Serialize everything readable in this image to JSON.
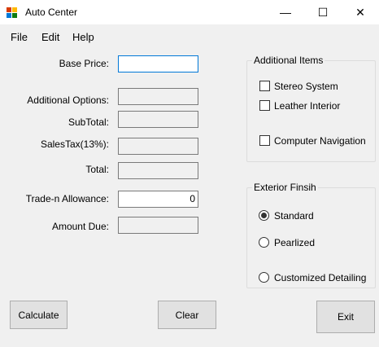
{
  "window": {
    "title": "Auto Center",
    "icon": "app-window-icon",
    "controls": {
      "minimize": "—",
      "maximize": "☐",
      "close": "✕"
    }
  },
  "menu": [
    "File",
    "Edit",
    "Help"
  ],
  "fields": {
    "base_price": {
      "label": "Base Price:",
      "value": ""
    },
    "additional_options": {
      "label": "Additional Options:",
      "value": ""
    },
    "subtotal": {
      "label": "SubTotal:",
      "value": ""
    },
    "sales_tax": {
      "label": "SalesTax(13%):",
      "value": ""
    },
    "total": {
      "label": "Total:",
      "value": ""
    },
    "trade_in": {
      "label": "Trade-n Allowance:",
      "value": "0"
    },
    "amount_due": {
      "label": "Amount Due:",
      "value": ""
    }
  },
  "additional_items": {
    "title": "Additional Items",
    "options": [
      {
        "label": "Stereo System",
        "checked": false
      },
      {
        "label": "Leather Interior",
        "checked": false
      },
      {
        "label": "Computer Navigation",
        "checked": false
      }
    ]
  },
  "exterior_finish": {
    "title": "Exterior Finsih",
    "options": [
      {
        "label": "Standard",
        "selected": true
      },
      {
        "label": "Pearlized",
        "selected": false
      },
      {
        "label": "Customized Detailing",
        "selected": false
      }
    ]
  },
  "buttons": {
    "calculate": "Calculate",
    "clear": "Clear",
    "exit": "Exit"
  },
  "colors": {
    "window_bg": "#f0f0f0",
    "focus_border": "#0078d7",
    "button_bg": "#e1e1e1"
  }
}
